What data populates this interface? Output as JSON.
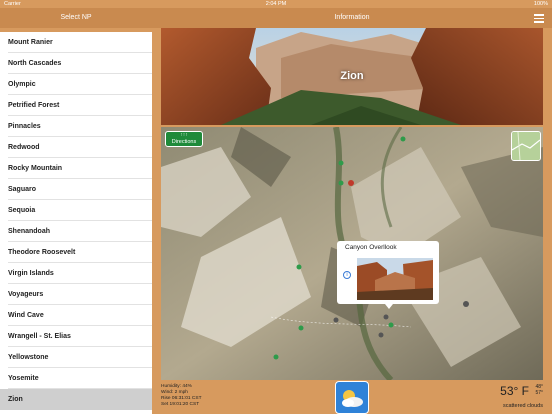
{
  "status_bar": {
    "carrier": "Carrier",
    "time": "2:04 PM",
    "battery": "100%"
  },
  "left_panel": {
    "title": "Select NP",
    "items": [
      {
        "label": "Mount Ranier"
      },
      {
        "label": "North Cascades"
      },
      {
        "label": "Olympic"
      },
      {
        "label": "Petrified Forest"
      },
      {
        "label": "Pinnacles"
      },
      {
        "label": "Redwood"
      },
      {
        "label": "Rocky Mountain"
      },
      {
        "label": "Saguaro"
      },
      {
        "label": "Sequoia"
      },
      {
        "label": "Shenandoah"
      },
      {
        "label": "Theodore Roosevelt"
      },
      {
        "label": "Virgin Islands"
      },
      {
        "label": "Voyageurs"
      },
      {
        "label": "Wind Cave"
      },
      {
        "label": "Wrangell - St. Elias"
      },
      {
        "label": "Yellowstone"
      },
      {
        "label": "Yosemite"
      },
      {
        "label": "Zion"
      }
    ],
    "selected": "Zion"
  },
  "right_panel": {
    "title": "Information",
    "hero_title": "Zion",
    "directions_label": "Directions",
    "popup_title": "Canyon Overllook",
    "weather": {
      "humidity": "Humidity: 44%",
      "wind": "Wind: 2 mph",
      "rise": "Rise 06:31:01 CST",
      "set": "Set 19:01:20 CST",
      "temp": "53° F",
      "high": "48°",
      "low": "57°",
      "description": "scattered clouds"
    }
  },
  "colors": {
    "bar": "#c98a4f",
    "directions": "#1f8a3a",
    "weather_icon_bg": "#2f82d8"
  }
}
